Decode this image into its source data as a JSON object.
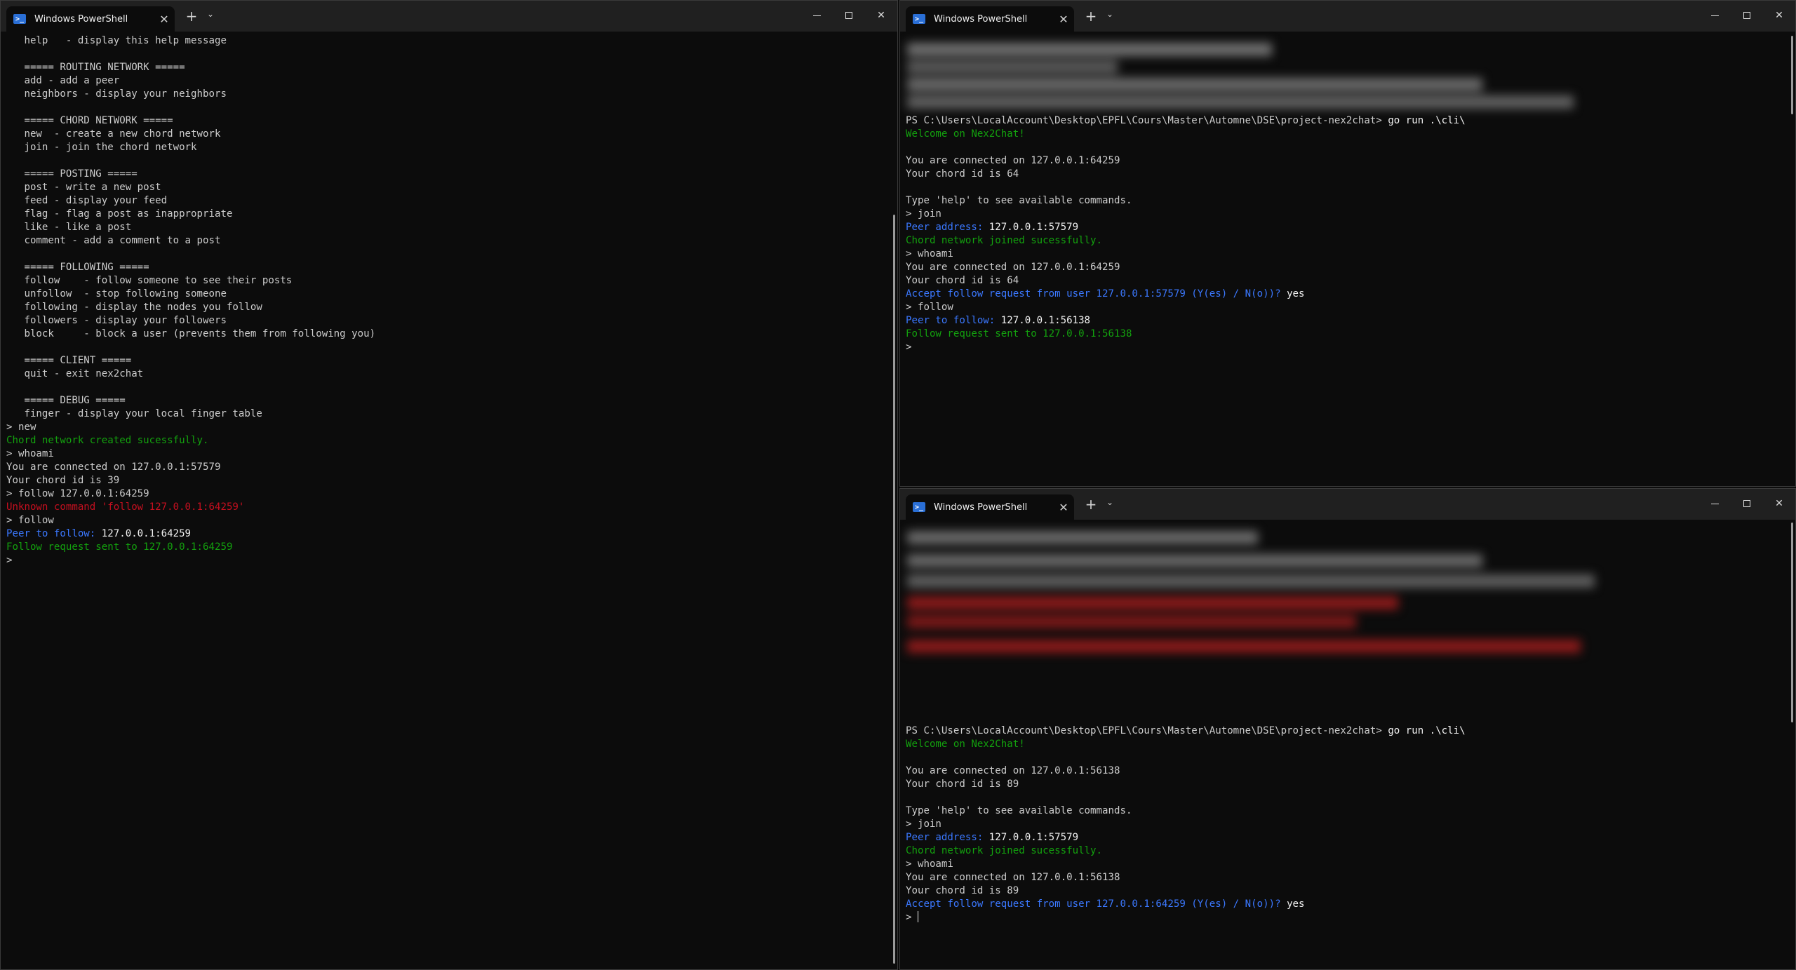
{
  "colors": {
    "background": "#0c0c0c",
    "titlebar": "#202020",
    "text": "#cccccc",
    "green": "#13a10e",
    "blue": "#3b78ff",
    "red": "#c50f1f"
  },
  "windows": {
    "left": {
      "tab_title": "Windows PowerShell",
      "lines": [
        {
          "t": "   help   - display this help message",
          "c": ""
        },
        {
          "t": "",
          "c": ""
        },
        {
          "t": "   ===== ROUTING NETWORK =====",
          "c": ""
        },
        {
          "t": "   add - add a peer",
          "c": ""
        },
        {
          "t": "   neighbors - display your neighbors",
          "c": ""
        },
        {
          "t": "",
          "c": ""
        },
        {
          "t": "   ===== CHORD NETWORK =====",
          "c": ""
        },
        {
          "t": "   new  - create a new chord network",
          "c": ""
        },
        {
          "t": "   join - join the chord network",
          "c": ""
        },
        {
          "t": "",
          "c": ""
        },
        {
          "t": "   ===== POSTING =====",
          "c": ""
        },
        {
          "t": "   post - write a new post",
          "c": ""
        },
        {
          "t": "   feed - display your feed",
          "c": ""
        },
        {
          "t": "   flag - flag a post as inappropriate",
          "c": ""
        },
        {
          "t": "   like - like a post",
          "c": ""
        },
        {
          "t": "   comment - add a comment to a post",
          "c": ""
        },
        {
          "t": "",
          "c": ""
        },
        {
          "t": "   ===== FOLLOWING =====",
          "c": ""
        },
        {
          "t": "   follow    - follow someone to see their posts",
          "c": ""
        },
        {
          "t": "   unfollow  - stop following someone",
          "c": ""
        },
        {
          "t": "   following - display the nodes you follow",
          "c": ""
        },
        {
          "t": "   followers - display your followers",
          "c": ""
        },
        {
          "t": "   block     - block a user (prevents them from following you)",
          "c": ""
        },
        {
          "t": "",
          "c": ""
        },
        {
          "t": "   ===== CLIENT =====",
          "c": ""
        },
        {
          "t": "   quit - exit nex2chat",
          "c": ""
        },
        {
          "t": "",
          "c": ""
        },
        {
          "t": "   ===== DEBUG =====",
          "c": ""
        },
        {
          "t": "   finger - display your local finger table",
          "c": ""
        },
        {
          "t": "> new",
          "c": ""
        },
        {
          "t": "Chord network created sucessfully.",
          "c": "green"
        },
        {
          "t": "> whoami",
          "c": ""
        },
        {
          "t": "You are connected on 127.0.0.1:57579",
          "c": ""
        },
        {
          "t": "Your chord id is 39",
          "c": ""
        },
        {
          "t": "> follow 127.0.0.1:64259",
          "c": ""
        },
        {
          "t": "Unknown command 'follow 127.0.0.1:64259'",
          "c": "red"
        },
        {
          "t": "> follow",
          "c": ""
        },
        {
          "t": "Peer to follow: ",
          "c": "blue",
          "v": "127.0.0.1:64259"
        },
        {
          "t": "Follow request sent to 127.0.0.1:64259",
          "c": "green"
        },
        {
          "t": ">",
          "c": ""
        }
      ]
    },
    "top_right": {
      "tab_title": "Windows PowerShell",
      "lines": [
        {
          "t": "PS C:\\Users\\LocalAccount\\Desktop\\EPFL\\Cours\\Master\\Automne\\DSE\\project-nex2chat> ",
          "c": "",
          "cmd": "go run .\\cli\\"
        },
        {
          "t": "Welcome on Nex2Chat!",
          "c": "green"
        },
        {
          "t": "",
          "c": ""
        },
        {
          "t": "You are connected on 127.0.0.1:64259",
          "c": ""
        },
        {
          "t": "Your chord id is 64",
          "c": ""
        },
        {
          "t": "",
          "c": ""
        },
        {
          "t": "Type 'help' to see available commands.",
          "c": ""
        },
        {
          "t": "> join",
          "c": ""
        },
        {
          "t": "Peer address: ",
          "c": "blue",
          "v": "127.0.0.1:57579"
        },
        {
          "t": "Chord network joined sucessfully.",
          "c": "green"
        },
        {
          "t": "> whoami",
          "c": ""
        },
        {
          "t": "You are connected on 127.0.0.1:64259",
          "c": ""
        },
        {
          "t": "Your chord id is 64",
          "c": ""
        },
        {
          "t": "Accept follow request from user 127.0.0.1:57579 (Y(es) / N(o))? ",
          "c": "blue",
          "v": "yes"
        },
        {
          "t": "> follow",
          "c": ""
        },
        {
          "t": "Peer to follow: ",
          "c": "blue",
          "v": "127.0.0.1:56138"
        },
        {
          "t": "Follow request sent to 127.0.0.1:56138",
          "c": "green"
        },
        {
          "t": ">",
          "c": ""
        }
      ]
    },
    "bottom_right": {
      "tab_title": "Windows PowerShell",
      "lines": [
        {
          "t": "PS C:\\Users\\LocalAccount\\Desktop\\EPFL\\Cours\\Master\\Automne\\DSE\\project-nex2chat> ",
          "c": "",
          "cmd": "go run .\\cli\\"
        },
        {
          "t": "Welcome on Nex2Chat!",
          "c": "green"
        },
        {
          "t": "",
          "c": ""
        },
        {
          "t": "You are connected on 127.0.0.1:56138",
          "c": ""
        },
        {
          "t": "Your chord id is 89",
          "c": ""
        },
        {
          "t": "",
          "c": ""
        },
        {
          "t": "Type 'help' to see available commands.",
          "c": ""
        },
        {
          "t": "> join",
          "c": ""
        },
        {
          "t": "Peer address: ",
          "c": "blue",
          "v": "127.0.0.1:57579"
        },
        {
          "t": "Chord network joined sucessfully.",
          "c": "green"
        },
        {
          "t": "> whoami",
          "c": ""
        },
        {
          "t": "You are connected on 127.0.0.1:56138",
          "c": ""
        },
        {
          "t": "Your chord id is 89",
          "c": ""
        },
        {
          "t": "Accept follow request from user 127.0.0.1:64259 (Y(es) / N(o))? ",
          "c": "blue",
          "v": "yes"
        },
        {
          "t": "> ",
          "c": "",
          "cursor": true
        }
      ]
    }
  }
}
